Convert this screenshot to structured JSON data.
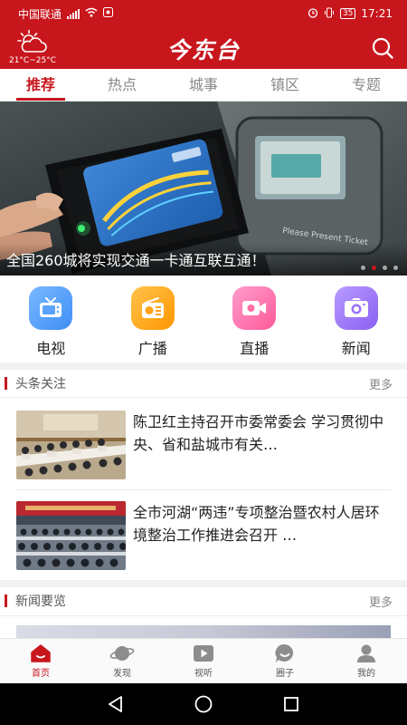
{
  "status_bar": {
    "carrier": "中国联通",
    "signal_tag": "4G",
    "battery": "35",
    "time": "17:21"
  },
  "header": {
    "weather_icon": "partly-cloudy-icon",
    "temperature": "21°C~25°C",
    "app_title": "今东台",
    "search_icon": "search-icon"
  },
  "tabs": [
    {
      "label": "推荐",
      "active": true
    },
    {
      "label": "热点",
      "active": false
    },
    {
      "label": "城事",
      "active": false
    },
    {
      "label": "镇区",
      "active": false
    },
    {
      "label": "专题",
      "active": false
    }
  ],
  "banner": {
    "caption": "全国260城将实现交通一卡通互联互通！",
    "image_text": "Please Present Ticket",
    "slide_count": 4,
    "active_slide": 2
  },
  "channels": [
    {
      "label": "电视",
      "icon": "tv-icon"
    },
    {
      "label": "广播",
      "icon": "radio-icon"
    },
    {
      "label": "直播",
      "icon": "video-camera-icon"
    },
    {
      "label": "新闻",
      "icon": "camera-icon"
    }
  ],
  "headline_section": {
    "title": "头条关注",
    "more": "更多",
    "items": [
      {
        "title": "陈卫红主持召开市委常委会  学习贯彻中央、省和盐城市有关…"
      },
      {
        "title": "全市河湖“两违”专项整治暨农村人居环境整治工作推进会召开 …"
      }
    ]
  },
  "news_section": {
    "title": "新闻要览",
    "more": "更多"
  },
  "bottom_nav": [
    {
      "label": "首页",
      "icon": "home-icon",
      "active": true
    },
    {
      "label": "发现",
      "icon": "planet-icon",
      "active": false
    },
    {
      "label": "视听",
      "icon": "play-icon",
      "active": false
    },
    {
      "label": "圈子",
      "icon": "chat-bubble-icon",
      "active": false
    },
    {
      "label": "我的",
      "icon": "user-icon",
      "active": false
    }
  ],
  "colors": {
    "brand_red": "#c8161d"
  }
}
